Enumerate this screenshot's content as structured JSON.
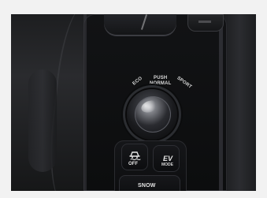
{
  "labels": {
    "eco": "ECO",
    "push": "PUSH",
    "normal": "NORMAL",
    "sport": "SPORT"
  },
  "buttons": {
    "traction_off": "OFF",
    "ev": "EV",
    "mode": "MODE",
    "snow": "SNOW"
  },
  "icons": {
    "traction": "traction-control-icon"
  },
  "colors": {
    "label": "#d8d8d8",
    "button_text": "#e6e6e6"
  }
}
